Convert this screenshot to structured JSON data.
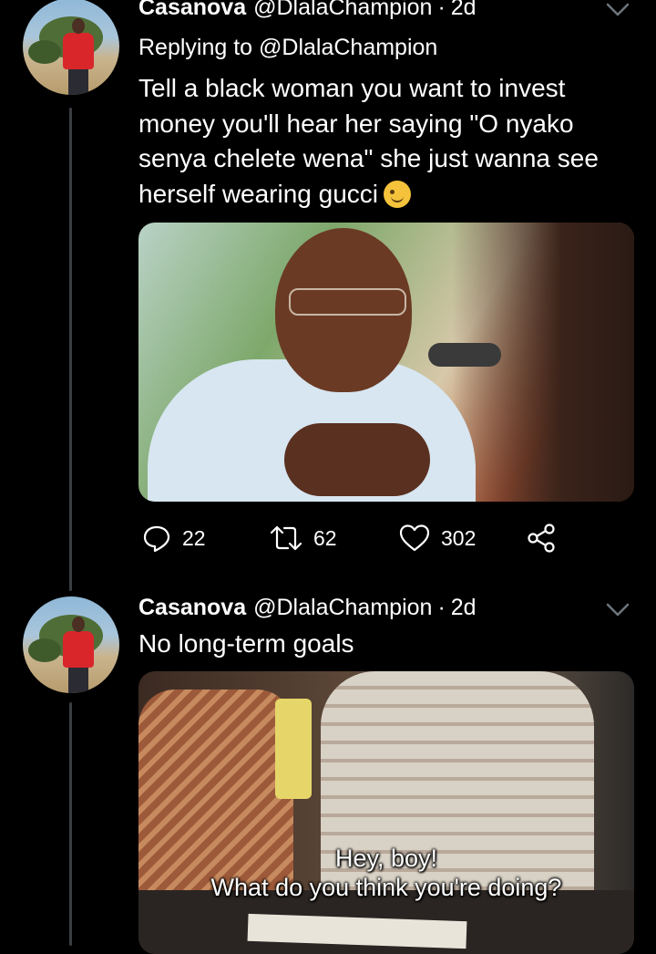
{
  "colors": {
    "background": "#000000",
    "text": "#ffffff",
    "thread_line": "#3a3d41"
  },
  "tweets": [
    {
      "name": "Casanova",
      "handle": "@DlalaChampion",
      "separator": "·",
      "age": "2d",
      "replying_to": "Replying to @DlalaChampion",
      "lines": [
        "Tell a black woman you want to invest",
        "money you'll hear her saying \"O nyako",
        "senya chelete wena\" she just wanna see",
        "herself wearing gucci"
      ],
      "emoji": "winking-face-emoji",
      "actions": {
        "replies": "22",
        "retweets": "62",
        "likes": "302"
      }
    },
    {
      "name": "Casanova",
      "handle": "@DlalaChampion",
      "separator": "·",
      "age": "2d",
      "text": "No long-term goals",
      "subtitles": [
        "Hey, boy!",
        "What do you think you're doing?"
      ]
    }
  ]
}
